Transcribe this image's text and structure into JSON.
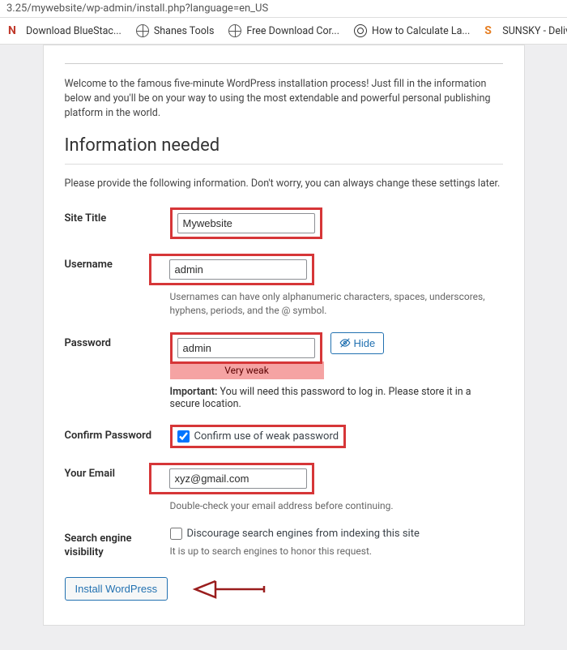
{
  "addr": {
    "url": "3.25/mywebsite/wp-admin/install.php?language=en_US"
  },
  "bookmarks": [
    {
      "label": "Download BlueStac..."
    },
    {
      "label": "Shanes Tools"
    },
    {
      "label": "Free Download Cor..."
    },
    {
      "label": "How to Calculate La..."
    },
    {
      "label": "SUNSKY - Deliv"
    }
  ],
  "intro": "Welcome to the famous five-minute WordPress installation process! Just fill in the information below and you'll be on your way to using the most extendable and powerful personal publishing platform in the world.",
  "heading": "Information needed",
  "subtext": "Please provide the following information. Don't worry, you can always change these settings later.",
  "form": {
    "site_title": {
      "label": "Site Title",
      "value": "Mywebsite"
    },
    "username": {
      "label": "Username",
      "value": "admin",
      "help": "Usernames can have only alphanumeric characters, spaces, underscores, hyphens, periods, and the @ symbol."
    },
    "password": {
      "label": "Password",
      "value": "admin",
      "hide_label": "Hide",
      "strength": "Very weak",
      "important_label": "Important:",
      "important_text": " You will need this password to log in. Please store it in a secure location."
    },
    "confirm_password": {
      "label": "Confirm Password",
      "checkbox_label": "Confirm use of weak password",
      "checked": true
    },
    "email": {
      "label": "Your Email",
      "value": "xyz@gmail.com",
      "help": "Double-check your email address before continuing."
    },
    "search_visibility": {
      "label": "Search engine visibility",
      "checkbox_label": "Discourage search engines from indexing this site",
      "help": "It is up to search engines to honor this request.",
      "checked": false
    }
  },
  "install_button": "Install WordPress"
}
